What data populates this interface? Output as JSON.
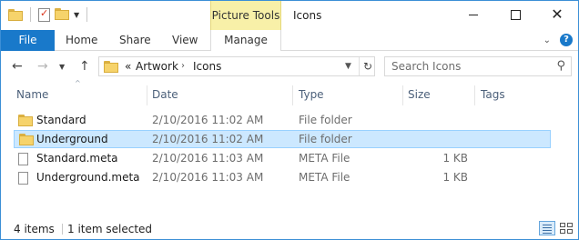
{
  "window": {
    "title": "Icons",
    "context_tab_header": "Picture Tools",
    "controls": {
      "minimize_icon": "minimize-icon",
      "maximize_icon": "maximize-icon",
      "close_icon": "close-icon"
    },
    "accent": "#1979ca",
    "context_color": "#f8f0a8"
  },
  "ribbon": {
    "tabs": [
      {
        "label": "File"
      },
      {
        "label": "Home"
      },
      {
        "label": "Share"
      },
      {
        "label": "View"
      },
      {
        "label": "Manage"
      }
    ],
    "help_glyph": "?"
  },
  "nav": {
    "breadcrumb": {
      "overflow": "«",
      "items": [
        "Artwork",
        "Icons"
      ]
    },
    "search_placeholder": "Search Icons"
  },
  "columns": [
    "Name",
    "Date",
    "Type",
    "Size",
    "Tags"
  ],
  "files": [
    {
      "name": "Standard",
      "date": "2/10/2016 11:02 AM",
      "type": "File folder",
      "size": "",
      "icon": "folder-icon",
      "selected": false
    },
    {
      "name": "Underground",
      "date": "2/10/2016 11:02 AM",
      "type": "File folder",
      "size": "",
      "icon": "folder-icon",
      "selected": true
    },
    {
      "name": "Standard.meta",
      "date": "2/10/2016 11:03 AM",
      "type": "META File",
      "size": "1 KB",
      "icon": "file-icon",
      "selected": false
    },
    {
      "name": "Underground.meta",
      "date": "2/10/2016 11:03 AM",
      "type": "META File",
      "size": "1 KB",
      "icon": "file-icon",
      "selected": false
    }
  ],
  "status": {
    "item_count": "4 items",
    "selection": "1 item selected"
  },
  "selection_color": "#cce8ff"
}
